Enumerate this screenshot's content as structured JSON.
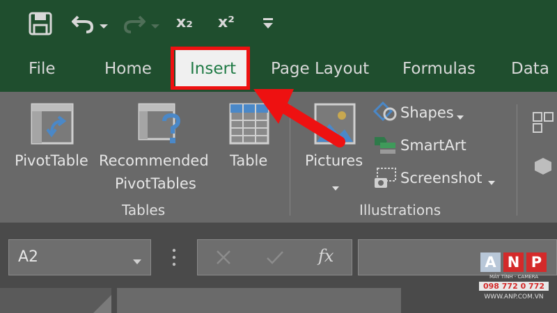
{
  "qat": {
    "subscript_label": "x₂",
    "superscript_label": "x²"
  },
  "tabs": [
    {
      "label": "File"
    },
    {
      "label": "Home"
    },
    {
      "label": "Insert"
    },
    {
      "label": "Page Layout"
    },
    {
      "label": "Formulas"
    },
    {
      "label": "Data"
    }
  ],
  "ribbon": {
    "tables_group": {
      "label": "Tables",
      "pivottable": "PivotTable",
      "recommended_line1": "Recommended",
      "recommended_line2": "PivotTables",
      "table": "Table"
    },
    "illustrations_group": {
      "label": "Illustrations",
      "pictures": "Pictures",
      "shapes": "Shapes",
      "smartart": "SmartArt",
      "screenshot": "Screenshot"
    }
  },
  "formula_bar": {
    "name_box_value": "A2",
    "fx_label": "fx"
  },
  "watermark": {
    "letters": [
      "A",
      "N",
      "P"
    ],
    "tagline": "MÁY TÍNH - CAMERA",
    "phone": "098 772 0 772",
    "website": "WWW.ANP.COM.VN"
  },
  "colors": {
    "title_bar": "#1f4e2e",
    "active_tab_text": "#1f7a45",
    "highlight_red": "#ee1111",
    "logo_red": "#d42a2a"
  }
}
